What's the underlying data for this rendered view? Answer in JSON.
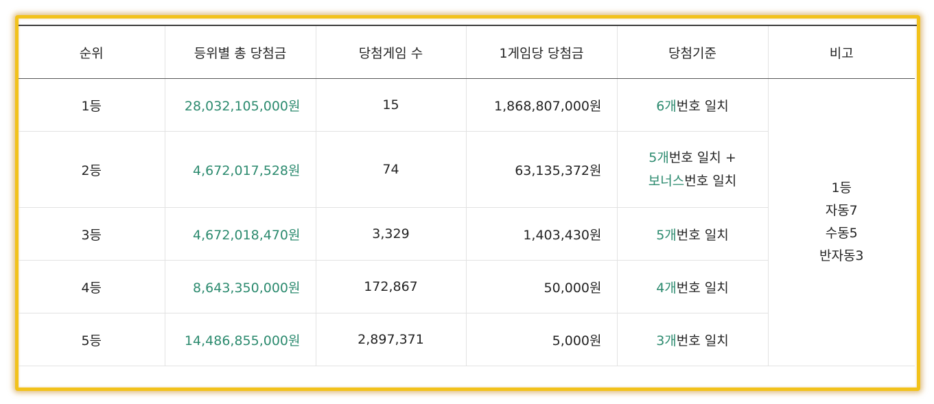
{
  "table": {
    "headers": [
      "순위",
      "등위별 총 당첨금",
      "당첨게임 수",
      "1게임당 당첨금",
      "당첨기준",
      "비고"
    ],
    "rows": [
      {
        "rank": "1등",
        "total": "28,032,105,000원",
        "games": "15",
        "per_game": "1,868,807,000원",
        "criteria": [
          {
            "count": "6개",
            "text": "번호 일치"
          }
        ]
      },
      {
        "rank": "2등",
        "total": "4,672,017,528원",
        "games": "74",
        "per_game": "63,135,372원",
        "criteria": [
          {
            "count": "5개",
            "text": "번호 일치 +"
          },
          {
            "count": "보너스",
            "text": "번호 일치"
          }
        ]
      },
      {
        "rank": "3등",
        "total": "4,672,018,470원",
        "games": "3,329",
        "per_game": "1,403,430원",
        "criteria": [
          {
            "count": "5개",
            "text": "번호 일치"
          }
        ]
      },
      {
        "rank": "4등",
        "total": "8,643,350,000원",
        "games": "172,867",
        "per_game": "50,000원",
        "criteria": [
          {
            "count": "4개",
            "text": "번호 일치"
          }
        ]
      },
      {
        "rank": "5등",
        "total": "14,486,855,000원",
        "games": "2,897,371",
        "per_game": "5,000원",
        "criteria": [
          {
            "count": "3개",
            "text": "번호 일치"
          }
        ]
      }
    ],
    "remarks": [
      "1등",
      "자동7",
      "수동5",
      "반자동3"
    ]
  },
  "colors": {
    "frame_border": "#f2c21b",
    "highlight_green": "#2b8a6e",
    "text": "#222222"
  }
}
